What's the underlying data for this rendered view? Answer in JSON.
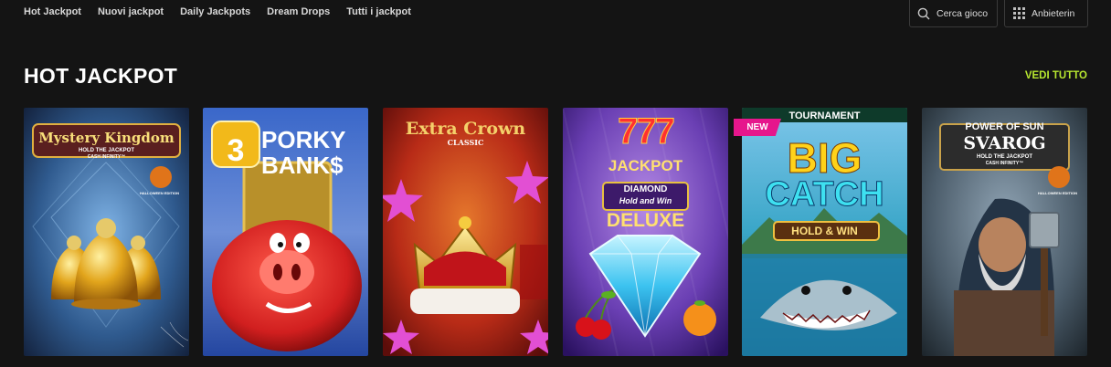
{
  "nav": {
    "items": [
      {
        "label": "Hot Jackpot"
      },
      {
        "label": "Nuovi jackpot"
      },
      {
        "label": "Daily Jackpots"
      },
      {
        "label": "Dream Drops"
      },
      {
        "label": "Tutti i jackpot"
      }
    ],
    "search_label": "Cerca gioco",
    "providers_label": "Anbieterin"
  },
  "section": {
    "title": "HOT JACKPOT",
    "see_all": "VEDI TUTTO"
  },
  "colors": {
    "background": "#141414",
    "accent": "#b8e830",
    "new_badge": "#e6168c"
  },
  "games": [
    {
      "title_line1": "Mystery Kingdom",
      "subtitle": "HOLD THE JACKPOT",
      "subtitle2": "CASH INFINITY™",
      "edition": "HALLOWEEN EDITION"
    },
    {
      "number": "3",
      "title_line1": "PORKY",
      "title_line2": "BANK$"
    },
    {
      "title_line1": "Extra Crown",
      "subtitle": "CLASSIC"
    },
    {
      "number": "777",
      "title_line1": "JACKPOT",
      "title_line2": "DIAMOND",
      "subtitle": "Hold and Win",
      "title_line3": "DELUXE"
    },
    {
      "badge": "NEW",
      "top_label": "TOURNAMENT",
      "title_line1": "BIG",
      "title_line2": "CATCH",
      "subtitle": "HOLD & WIN"
    },
    {
      "title_line1": "POWER OF SUN",
      "title_line2": "SVAROG",
      "subtitle": "HOLD THE JACKPOT",
      "subtitle2": "CASH INFINITY™",
      "edition": "HALLOWEEN EDITION"
    }
  ]
}
